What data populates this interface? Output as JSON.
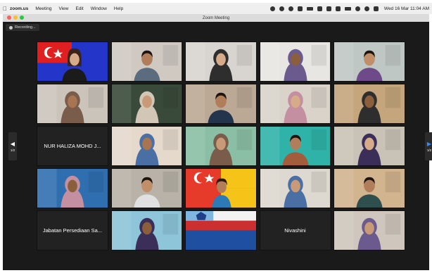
{
  "menubar": {
    "app_name": "zoom.us",
    "items": [
      "Meeting",
      "View",
      "Edit",
      "Window",
      "Help"
    ],
    "clock": "Wed 16 Mar 11:04 AM"
  },
  "window": {
    "title": "Zoom Meeting"
  },
  "recording": {
    "label": "Recording..."
  },
  "pagination": {
    "left": "1/2",
    "right": "1/2"
  },
  "tiles": [
    {
      "type": "flag-terengganu-video"
    },
    {
      "type": "video",
      "bg": "#cfc9c2"
    },
    {
      "type": "video",
      "bg": "#d8d4cf"
    },
    {
      "type": "video",
      "bg": "#e8e6e3"
    },
    {
      "type": "video",
      "bg": "#bfc7c4"
    },
    {
      "type": "video",
      "bg": "#cbc4bb"
    },
    {
      "type": "video",
      "bg": "#3a4a3a"
    },
    {
      "type": "video",
      "bg": "#bba995"
    },
    {
      "type": "video",
      "bg": "#d9d3ca"
    },
    {
      "type": "video",
      "bg": "#c4a57c"
    },
    {
      "type": "name",
      "name": "NUR HALIZA MOHD J..."
    },
    {
      "type": "video",
      "bg": "#e5d9cc"
    },
    {
      "type": "video",
      "bg": "#8bbfa5"
    },
    {
      "type": "video",
      "bg": "#2fb3a8"
    },
    {
      "type": "video",
      "bg": "#c9c2b6"
    },
    {
      "type": "video",
      "bg": "#2f6fb0"
    },
    {
      "type": "video",
      "bg": "#b8b2a8"
    },
    {
      "type": "flag-selangor-video"
    },
    {
      "type": "video",
      "bg": "#ddd8d0"
    },
    {
      "type": "video",
      "bg": "#d2b48f"
    },
    {
      "type": "name",
      "name": "Jabatan Persediaan Sa..."
    },
    {
      "type": "video",
      "bg": "#8ec5d9"
    },
    {
      "type": "flag-sabah"
    },
    {
      "type": "name",
      "name": "Nivashini"
    },
    {
      "type": "video",
      "bg": "#cfc7bd"
    }
  ],
  "colors": {
    "zoom_blue": "#2d8cff",
    "active_speaker": "#f4d03f",
    "meeting_bg": "#1a1a1a"
  }
}
